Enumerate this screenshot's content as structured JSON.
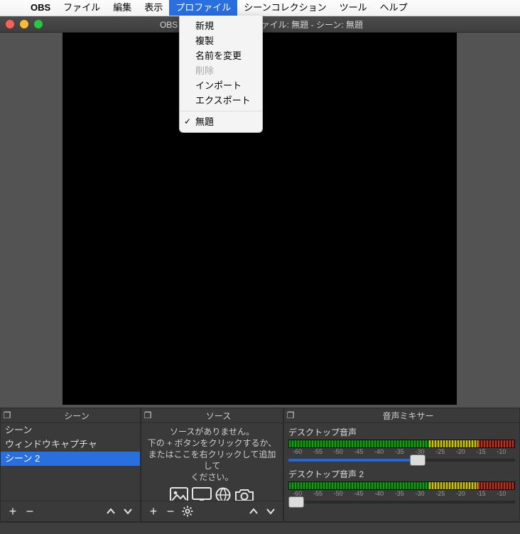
{
  "menubar": {
    "appname": "OBS",
    "items": [
      "ファイル",
      "編集",
      "表示",
      "プロファイル",
      "シーンコレクション",
      "ツール",
      "ヘルプ"
    ],
    "highlight_index": 3
  },
  "dropdown": {
    "items": [
      {
        "label": "新規",
        "type": "item"
      },
      {
        "label": "複製",
        "type": "item"
      },
      {
        "label": "名前を変更",
        "type": "item"
      },
      {
        "label": "削除",
        "type": "disabled"
      },
      {
        "label": "インポート",
        "type": "item"
      },
      {
        "label": "エクスポート",
        "type": "item"
      },
      {
        "label": "",
        "type": "sep"
      },
      {
        "label": "無題",
        "type": "checked"
      }
    ]
  },
  "window": {
    "title": "OBS 25.0.8 (mac) - プロファイル: 無題 - シーン: 無題"
  },
  "panels": {
    "scenes_title": "シーン",
    "sources_title": "ソース",
    "mixer_title": "音声ミキサー"
  },
  "scenes": {
    "items": [
      "シーン",
      "ウィンドウキャプチャ",
      "シーン 2"
    ],
    "selected_index": 2
  },
  "sources_hint": {
    "l1": "ソースがありません。",
    "l2": "下の + ボタンをクリックするか、",
    "l3": "またはここを右クリックして追加して",
    "l4": "ください。"
  },
  "mixer": {
    "track1_label": "デスクトップ音声",
    "track2_label": "デスクトップ音声 2",
    "ticks": [
      "-60",
      "-55",
      "-50",
      "-45",
      "-40",
      "-35",
      "-30",
      "-25",
      "-20",
      "-15",
      "-10"
    ]
  }
}
